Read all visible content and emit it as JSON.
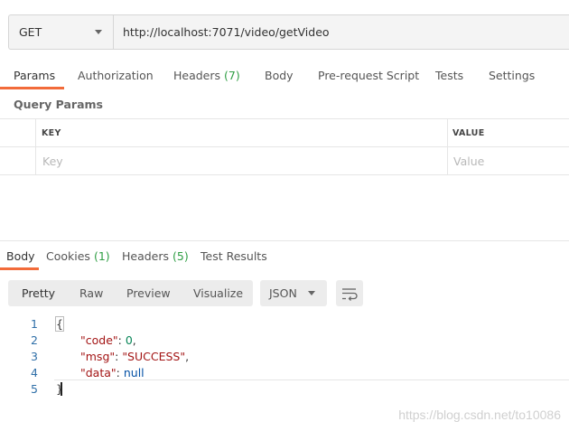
{
  "request": {
    "method": "GET",
    "url": "http://localhost:7071/video/getVideo"
  },
  "request_tabs": [
    {
      "label": "Params",
      "count": ""
    },
    {
      "label": "Authorization",
      "count": ""
    },
    {
      "label": "Headers",
      "count": "(7)"
    },
    {
      "label": "Body",
      "count": ""
    },
    {
      "label": "Pre-request Script",
      "count": ""
    },
    {
      "label": "Tests",
      "count": ""
    },
    {
      "label": "Settings",
      "count": ""
    }
  ],
  "query_params": {
    "title": "Query Params",
    "columns": [
      "KEY",
      "VALUE"
    ],
    "key_placeholder": "Key",
    "value_placeholder": "Value"
  },
  "response_tabs": [
    {
      "label": "Body",
      "count": ""
    },
    {
      "label": "Cookies",
      "count": "(1)"
    },
    {
      "label": "Headers",
      "count": "(5)"
    },
    {
      "label": "Test Results",
      "count": ""
    }
  ],
  "view_modes": [
    "Pretty",
    "Raw",
    "Preview",
    "Visualize"
  ],
  "format": "JSON",
  "code_lines": [
    "1",
    "2",
    "3",
    "4",
    "5"
  ],
  "code": {
    "open": "{",
    "code_key": "\"code\"",
    "code_val": "0",
    "msg_key": "\"msg\"",
    "msg_val": "\"SUCCESS\"",
    "data_key": "\"data\"",
    "data_val": "null",
    "close": "}"
  },
  "watermark": "https://blog.csdn.net/to10086",
  "colors": {
    "accent": "#f26b3a",
    "count_green": "#2f9e44"
  }
}
